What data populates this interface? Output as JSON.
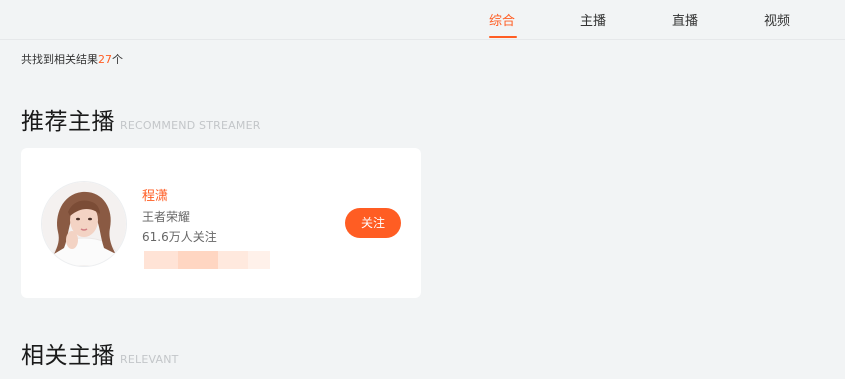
{
  "nav": {
    "tabs": [
      {
        "label": "综合",
        "active": true
      },
      {
        "label": "主播",
        "active": false
      },
      {
        "label": "直播",
        "active": false
      },
      {
        "label": "视频",
        "active": false
      }
    ]
  },
  "results": {
    "prefix": "共找到相关结果",
    "count": "27",
    "suffix": "个"
  },
  "recommend_section": {
    "title": "推荐主播",
    "subtitle": "RECOMMEND STREAMER"
  },
  "streamer_card": {
    "name": "程潇",
    "category": "王者荣耀",
    "followers": "61.6万人关注",
    "follow_label": "关注",
    "avatar_icon": "avatar-photo-icon"
  },
  "relevant_section": {
    "title": "相关主播",
    "subtitle": "RELEVANT"
  },
  "colors": {
    "accent": "#ff5d23",
    "background": "#f2f4f5",
    "card": "#ffffff",
    "tag_bar": [
      "#ffe3d6",
      "#ffd6c2",
      "#ffe9de",
      "#fff1ea"
    ]
  }
}
